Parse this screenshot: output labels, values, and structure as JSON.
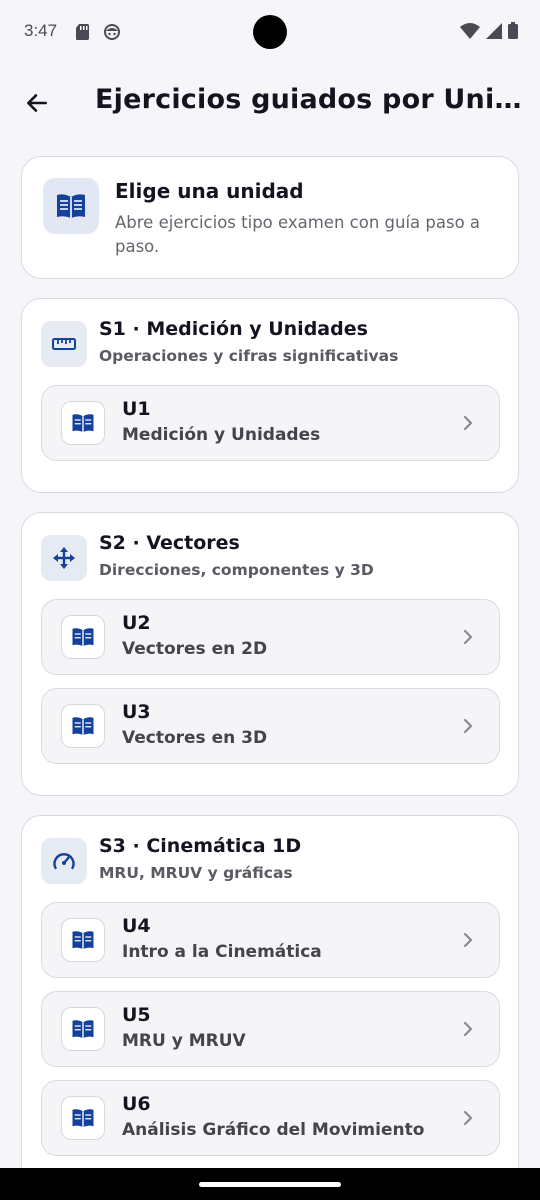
{
  "status": {
    "time": "3:47"
  },
  "header": {
    "title": "Ejercicios guiados por Unidad"
  },
  "intro": {
    "title": "Elige una unidad",
    "description": "Abre ejercicios tipo examen con guía paso a paso."
  },
  "sections": [
    {
      "title": "S1 · Medición y Unidades",
      "subtitle": "Operaciones y cifras significativas",
      "icon": "ruler-icon",
      "units": [
        {
          "code": "U1",
          "name": "Medición y Unidades"
        }
      ]
    },
    {
      "title": "S2 · Vectores",
      "subtitle": "Direcciones, componentes y 3D",
      "icon": "move-arrows-icon",
      "units": [
        {
          "code": "U2",
          "name": "Vectores en 2D"
        },
        {
          "code": "U3",
          "name": "Vectores en 3D"
        }
      ]
    },
    {
      "title": "S3 · Cinemática 1D",
      "subtitle": "MRU, MRUV y gráficas",
      "icon": "speedometer-icon",
      "units": [
        {
          "code": "U4",
          "name": "Intro a la Cinemática"
        },
        {
          "code": "U5",
          "name": "MRU y MRUV"
        },
        {
          "code": "U6",
          "name": "Análisis Gráfico del Movimiento"
        }
      ]
    }
  ],
  "colors": {
    "accent": "#14419b",
    "background": "#f6f6fa",
    "icon_bg": "#e6ebf3"
  }
}
